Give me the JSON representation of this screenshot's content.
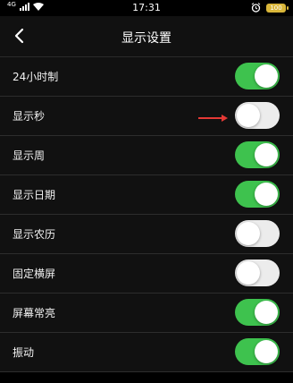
{
  "status_bar": {
    "network": "4G",
    "time": "17:31",
    "battery": "100"
  },
  "header": {
    "title": "显示设置",
    "back_icon": "chevron-left-icon"
  },
  "colors": {
    "toggle_on": "#3ec24e",
    "toggle_off": "#ececec",
    "arrow": "#e53935"
  },
  "settings": [
    {
      "label": "24小时制",
      "on": true
    },
    {
      "label": "显示秒",
      "on": false
    },
    {
      "label": "显示周",
      "on": true
    },
    {
      "label": "显示日期",
      "on": true
    },
    {
      "label": "显示农历",
      "on": false
    },
    {
      "label": "固定横屏",
      "on": false
    },
    {
      "label": "屏幕常亮",
      "on": true
    },
    {
      "label": "振动",
      "on": true
    }
  ]
}
